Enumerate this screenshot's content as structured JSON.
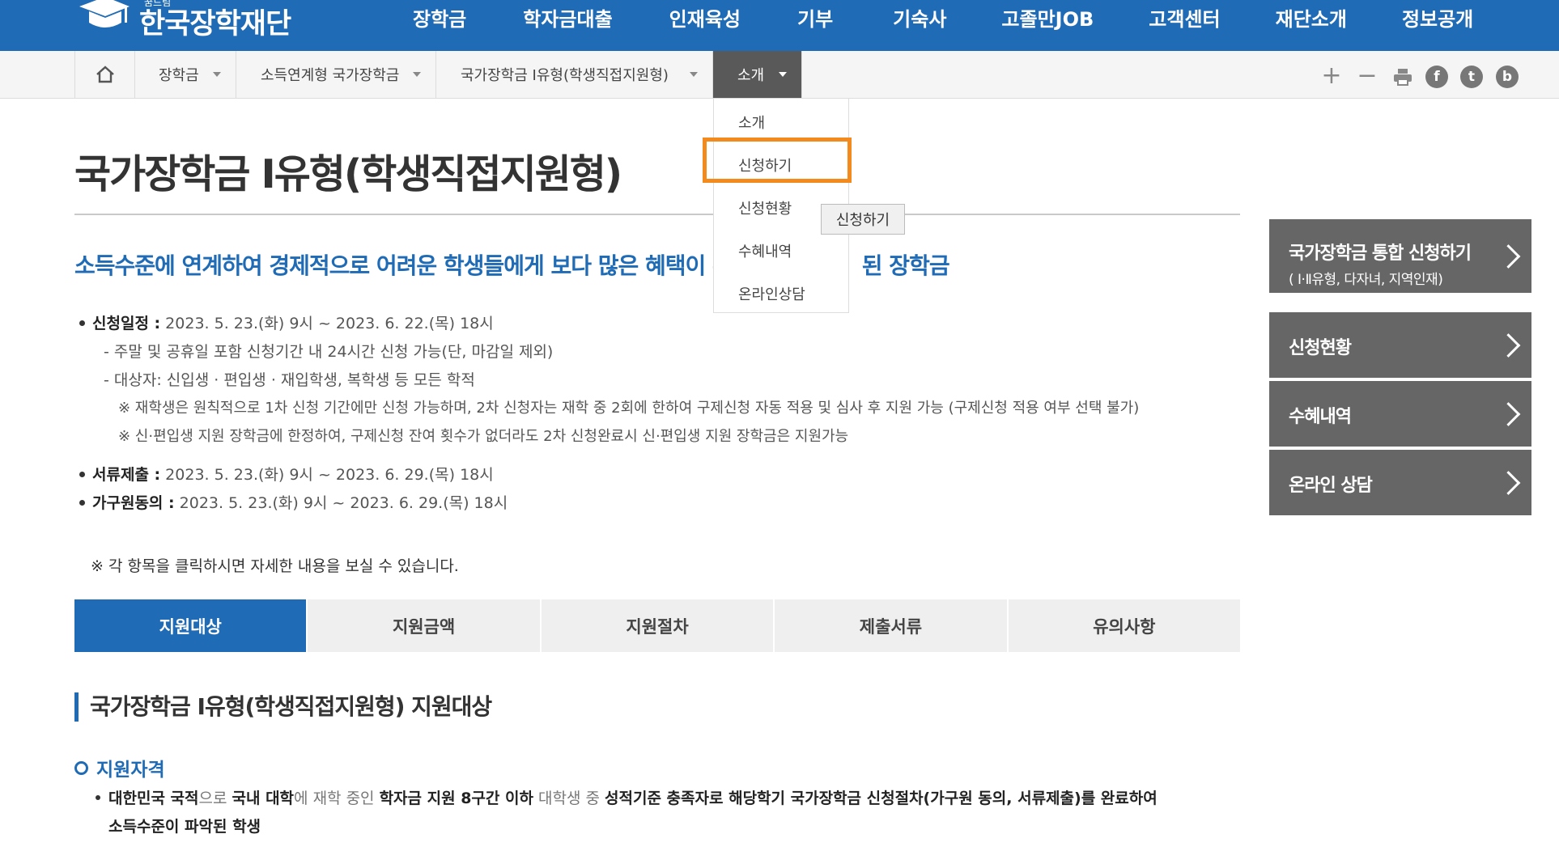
{
  "brand": {
    "logo_text": "한국장학재단",
    "logo_sub": "꿈드림"
  },
  "gnb": [
    "장학금",
    "학자금대출",
    "인재육성",
    "기부",
    "기숙사",
    "고졸만JOB",
    "고객센터",
    "재단소개",
    "정보공개"
  ],
  "breadcrumb": [
    {
      "label": "장학금"
    },
    {
      "label": "소득연계형 국가장학금"
    },
    {
      "label": "국가장학금 Ⅰ유형(학생직접지원형)"
    },
    {
      "label": "소개"
    }
  ],
  "dropdown": {
    "items": [
      "소개",
      "신청하기",
      "신청현황",
      "수혜내역",
      "온라인상담"
    ],
    "highlighted": "신청하기",
    "tooltip": "신청하기"
  },
  "utility_icons": [
    "zoom-in",
    "zoom-out",
    "print",
    "facebook",
    "twitter",
    "blog"
  ],
  "utility_glyphs": {
    "facebook": "f",
    "twitter": "t",
    "blog": "b",
    "plus": "+",
    "minus": "−"
  },
  "page": {
    "title": "국가장학금 Ⅰ유형(학생직접지원형)",
    "lead": "소득수준에 연계하여 경제적으로 어려운 학생들에게 보다 많은 혜택이 주",
    "lead_tail": "된 장학금"
  },
  "schedule": {
    "apply_label": "신청일정 :",
    "apply_value": " 2023. 5. 23.(화) 9시 ~ 2023. 6. 22.(목) 18시",
    "sub1": "- 주말 및 공휴일 포함 신청기간 내 24시간 신청 가능(단, 마감일 제외)",
    "sub2": "- 대상자: 신입생 · 편입생 · 재입학생, 복학생 등 모든 학적",
    "note1": "※ 재학생은 원칙적으로 1차 신청 기간에만 신청 가능하며, 2차 신청자는 재학 중 2회에 한하여 구제신청 자동 적용 및 심사 후 지원 가능 (구제신청 적용 여부 선택 불가)",
    "note2": "※ 신·편입생 지원 장학금에 한정하여, 구제신청 잔여 횟수가 없더라도 2차 신청완료시 신·편입생 지원 장학금은 지원가능",
    "docs_label": "서류제출 :",
    "docs_value": " 2023. 5. 23.(화) 9시 ~ 2023. 6. 29.(목) 18시",
    "consent_label": "가구원동의 :",
    "consent_value": " 2023. 5. 23.(화) 9시 ~ 2023. 6. 29.(목) 18시"
  },
  "notice": "※ 각 항목을 클릭하시면 자세한 내용을 보실 수 있습니다.",
  "tabs": [
    "지원대상",
    "지원금액",
    "지원절차",
    "제출서류",
    "유의사항"
  ],
  "active_tab": "지원대상",
  "section": {
    "heading": "국가장학금 Ⅰ유형(학생직접지원형) 지원대상",
    "subheading": "지원자격",
    "p1": "대한민국 국적",
    "p2": "으로 ",
    "p3": "국내 대학",
    "p4": "에 재학 중인 ",
    "p5": "학자금 지원 8구간 이하",
    "p6": " 대학생 중 ",
    "p7": "성적기준 충족자로 해당학기 국가장학금 신청절차(가구원 동의, 서류제출)를 완료하여",
    "p8": "소득수준이 파악된 학생"
  },
  "quick_menu": [
    {
      "label": "국가장학금 통합 신청하기",
      "sub": "( Ⅰ·Ⅱ유형, 다자녀, 지역인재)"
    },
    {
      "label": "신청현황"
    },
    {
      "label": "수혜내역"
    },
    {
      "label": "온라인 상담"
    }
  ],
  "colors": {
    "brand_blue": "#1f6bb6",
    "highlight_orange": "#f28a1e",
    "quick_gray": "#666666"
  }
}
